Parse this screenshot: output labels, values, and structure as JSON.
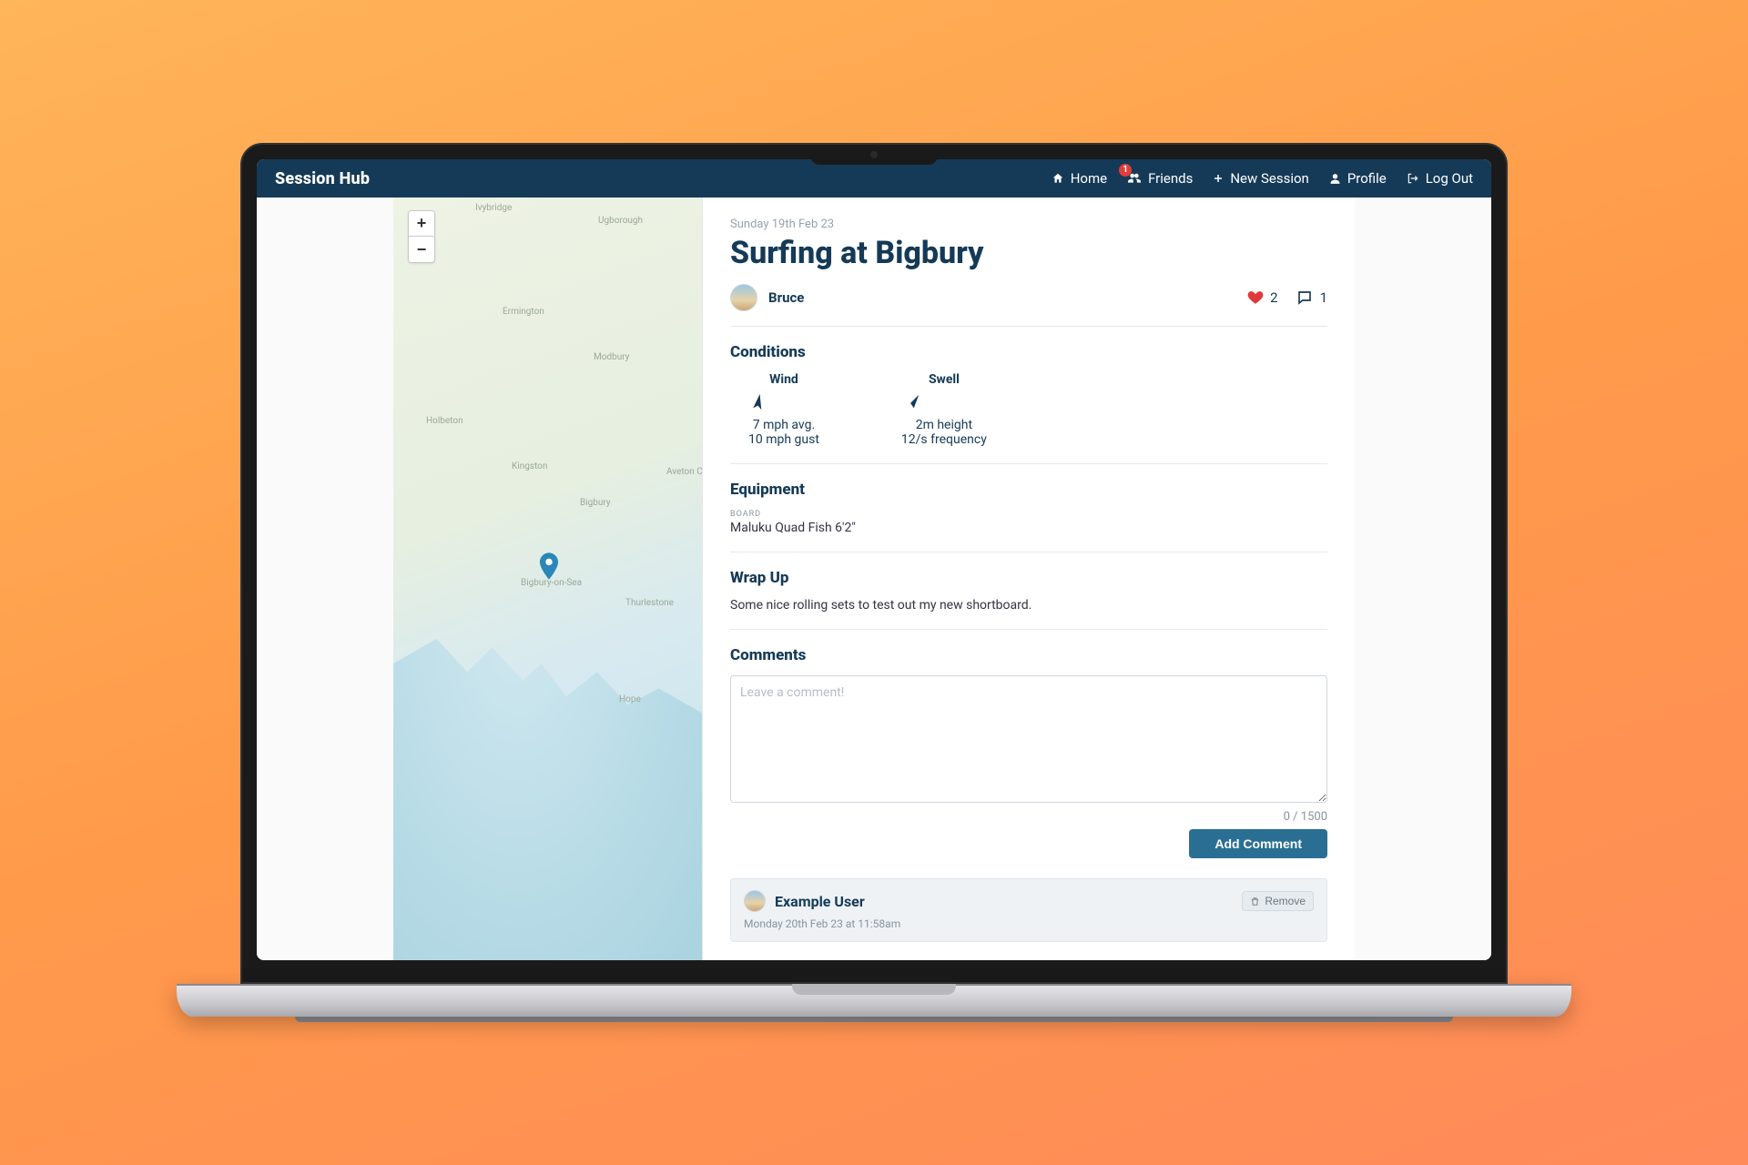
{
  "brand": "Session Hub",
  "nav": {
    "home": "Home",
    "friends": "Friends",
    "friends_badge": "1",
    "new_session": "New Session",
    "profile": "Profile",
    "logout": "Log Out"
  },
  "map": {
    "zoom_in": "+",
    "zoom_out": "−",
    "labels": {
      "ivybridge": "Ivybridge",
      "ugborough": "Ugborough",
      "ermington": "Ermington",
      "modbury": "Modbury",
      "holbeton": "Holbeton",
      "kingston": "Kingston",
      "avetonc": "Aveton C",
      "bigbury": "Bigbury",
      "bigbury_on_sea": "Bigbury-on-Sea",
      "thurlestone": "Thurlestone",
      "hope": "Hope"
    }
  },
  "session": {
    "date": "Sunday 19th Feb 23",
    "title": "Surfing at Bigbury",
    "author": "Bruce",
    "likes": "2",
    "comments_count": "1"
  },
  "conditions": {
    "heading": "Conditions",
    "wind": {
      "label": "Wind",
      "avg": "7 mph avg.",
      "gust": "10 mph gust"
    },
    "swell": {
      "label": "Swell",
      "height": "2m height",
      "frequency": "12/s frequency"
    }
  },
  "equipment": {
    "heading": "Equipment",
    "board_label": "BOARD",
    "board_value": "Maluku Quad Fish 6'2\""
  },
  "wrapup": {
    "heading": "Wrap Up",
    "text": "Some nice rolling sets to test out my new shortboard."
  },
  "comments": {
    "heading": "Comments",
    "placeholder": "Leave a comment!",
    "counter": "0 / 1500",
    "submit": "Add Comment",
    "list": [
      {
        "user": "Example User",
        "time": "Monday 20th Feb 23 at 11:58am",
        "remove": "Remove"
      }
    ]
  }
}
